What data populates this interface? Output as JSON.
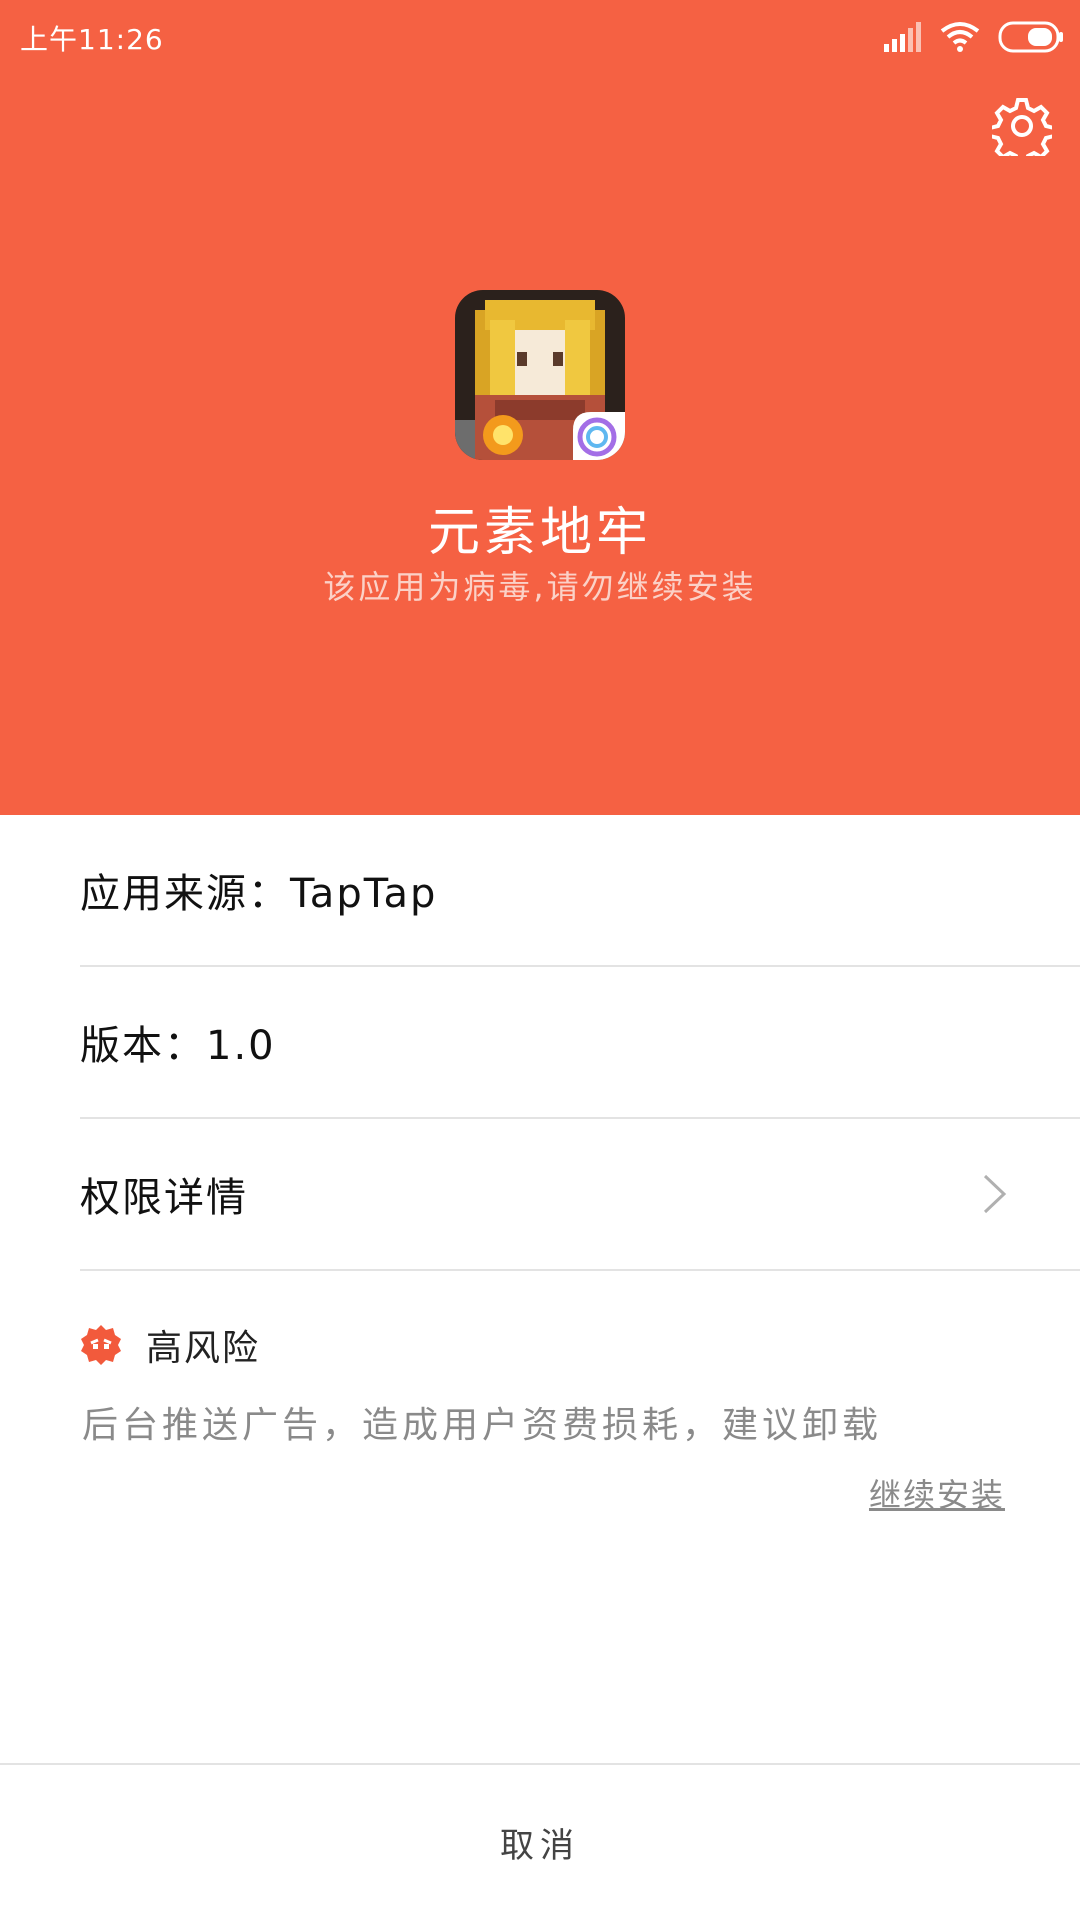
{
  "status_bar": {
    "time": "上午11:26",
    "icons": [
      "signal-icon",
      "wifi-icon",
      "battery-icon"
    ]
  },
  "header": {
    "settings_icon": "gear-icon",
    "app_name": "元素地牢",
    "warning": "该应用为病毒,请勿继续安装",
    "background_color": "#f56143"
  },
  "details": {
    "source": "应用来源：TapTap",
    "version": "版本：1.0",
    "permissions": "权限详情"
  },
  "risk": {
    "level": "高风险",
    "description": "后台推送广告，造成用户资费损耗，建议卸载",
    "continue_install": "继续安装",
    "icon": "danger-badge-icon"
  },
  "footer": {
    "cancel": "取消"
  }
}
